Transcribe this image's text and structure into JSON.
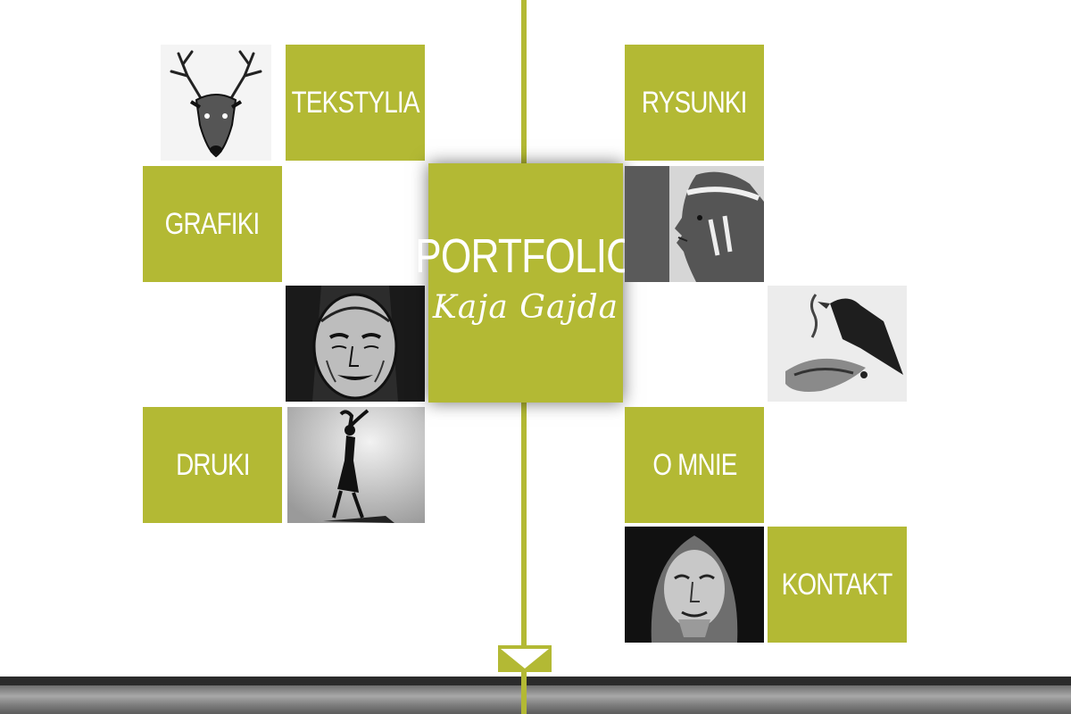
{
  "brand": {
    "title": "PORTFOLIO",
    "signature": "Kaja Gajda"
  },
  "menu": {
    "tekstylia": "TEKSTYLIA",
    "grafiki": "GRAFIKI",
    "druki": "DRUKI",
    "rysunki": "RYSUNKI",
    "o_mnie": "O MNIE",
    "kontakt": "KONTAKT"
  },
  "images": {
    "deer": "deer-drawing",
    "old_woman": "old-woman-drawing",
    "dancer": "dancer-photo",
    "profile": "profile-portrait",
    "crow": "crow-drawing",
    "hooded_woman": "hooded-old-woman-portrait"
  },
  "colors": {
    "accent": "#b3b934",
    "text": "#ffffff",
    "background": "#ffffff",
    "footer": "#2b2b2b"
  },
  "icons": {
    "scroll_down": "chevron-down-triangle-icon"
  }
}
